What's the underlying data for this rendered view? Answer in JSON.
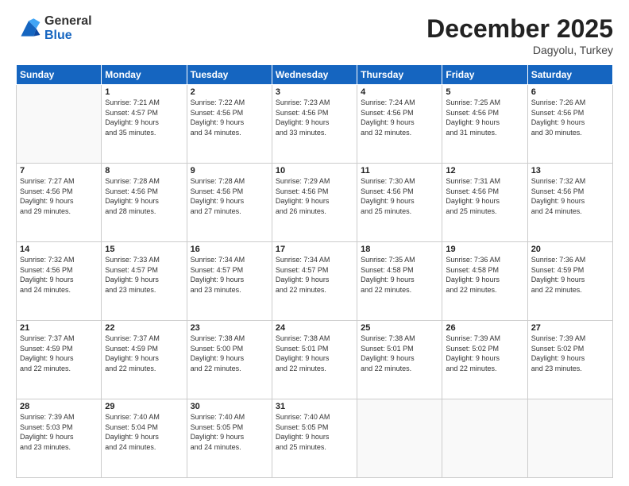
{
  "header": {
    "logo_general": "General",
    "logo_blue": "Blue",
    "month": "December 2025",
    "location": "Dagyolu, Turkey"
  },
  "weekdays": [
    "Sunday",
    "Monday",
    "Tuesday",
    "Wednesday",
    "Thursday",
    "Friday",
    "Saturday"
  ],
  "weeks": [
    [
      {
        "day": "",
        "info": ""
      },
      {
        "day": "1",
        "info": "Sunrise: 7:21 AM\nSunset: 4:57 PM\nDaylight: 9 hours\nand 35 minutes."
      },
      {
        "day": "2",
        "info": "Sunrise: 7:22 AM\nSunset: 4:56 PM\nDaylight: 9 hours\nand 34 minutes."
      },
      {
        "day": "3",
        "info": "Sunrise: 7:23 AM\nSunset: 4:56 PM\nDaylight: 9 hours\nand 33 minutes."
      },
      {
        "day": "4",
        "info": "Sunrise: 7:24 AM\nSunset: 4:56 PM\nDaylight: 9 hours\nand 32 minutes."
      },
      {
        "day": "5",
        "info": "Sunrise: 7:25 AM\nSunset: 4:56 PM\nDaylight: 9 hours\nand 31 minutes."
      },
      {
        "day": "6",
        "info": "Sunrise: 7:26 AM\nSunset: 4:56 PM\nDaylight: 9 hours\nand 30 minutes."
      }
    ],
    [
      {
        "day": "7",
        "info": "Sunrise: 7:27 AM\nSunset: 4:56 PM\nDaylight: 9 hours\nand 29 minutes."
      },
      {
        "day": "8",
        "info": "Sunrise: 7:28 AM\nSunset: 4:56 PM\nDaylight: 9 hours\nand 28 minutes."
      },
      {
        "day": "9",
        "info": "Sunrise: 7:28 AM\nSunset: 4:56 PM\nDaylight: 9 hours\nand 27 minutes."
      },
      {
        "day": "10",
        "info": "Sunrise: 7:29 AM\nSunset: 4:56 PM\nDaylight: 9 hours\nand 26 minutes."
      },
      {
        "day": "11",
        "info": "Sunrise: 7:30 AM\nSunset: 4:56 PM\nDaylight: 9 hours\nand 25 minutes."
      },
      {
        "day": "12",
        "info": "Sunrise: 7:31 AM\nSunset: 4:56 PM\nDaylight: 9 hours\nand 25 minutes."
      },
      {
        "day": "13",
        "info": "Sunrise: 7:32 AM\nSunset: 4:56 PM\nDaylight: 9 hours\nand 24 minutes."
      }
    ],
    [
      {
        "day": "14",
        "info": "Sunrise: 7:32 AM\nSunset: 4:56 PM\nDaylight: 9 hours\nand 24 minutes."
      },
      {
        "day": "15",
        "info": "Sunrise: 7:33 AM\nSunset: 4:57 PM\nDaylight: 9 hours\nand 23 minutes."
      },
      {
        "day": "16",
        "info": "Sunrise: 7:34 AM\nSunset: 4:57 PM\nDaylight: 9 hours\nand 23 minutes."
      },
      {
        "day": "17",
        "info": "Sunrise: 7:34 AM\nSunset: 4:57 PM\nDaylight: 9 hours\nand 22 minutes."
      },
      {
        "day": "18",
        "info": "Sunrise: 7:35 AM\nSunset: 4:58 PM\nDaylight: 9 hours\nand 22 minutes."
      },
      {
        "day": "19",
        "info": "Sunrise: 7:36 AM\nSunset: 4:58 PM\nDaylight: 9 hours\nand 22 minutes."
      },
      {
        "day": "20",
        "info": "Sunrise: 7:36 AM\nSunset: 4:59 PM\nDaylight: 9 hours\nand 22 minutes."
      }
    ],
    [
      {
        "day": "21",
        "info": "Sunrise: 7:37 AM\nSunset: 4:59 PM\nDaylight: 9 hours\nand 22 minutes."
      },
      {
        "day": "22",
        "info": "Sunrise: 7:37 AM\nSunset: 4:59 PM\nDaylight: 9 hours\nand 22 minutes."
      },
      {
        "day": "23",
        "info": "Sunrise: 7:38 AM\nSunset: 5:00 PM\nDaylight: 9 hours\nand 22 minutes."
      },
      {
        "day": "24",
        "info": "Sunrise: 7:38 AM\nSunset: 5:01 PM\nDaylight: 9 hours\nand 22 minutes."
      },
      {
        "day": "25",
        "info": "Sunrise: 7:38 AM\nSunset: 5:01 PM\nDaylight: 9 hours\nand 22 minutes."
      },
      {
        "day": "26",
        "info": "Sunrise: 7:39 AM\nSunset: 5:02 PM\nDaylight: 9 hours\nand 22 minutes."
      },
      {
        "day": "27",
        "info": "Sunrise: 7:39 AM\nSunset: 5:02 PM\nDaylight: 9 hours\nand 23 minutes."
      }
    ],
    [
      {
        "day": "28",
        "info": "Sunrise: 7:39 AM\nSunset: 5:03 PM\nDaylight: 9 hours\nand 23 minutes."
      },
      {
        "day": "29",
        "info": "Sunrise: 7:40 AM\nSunset: 5:04 PM\nDaylight: 9 hours\nand 24 minutes."
      },
      {
        "day": "30",
        "info": "Sunrise: 7:40 AM\nSunset: 5:05 PM\nDaylight: 9 hours\nand 24 minutes."
      },
      {
        "day": "31",
        "info": "Sunrise: 7:40 AM\nSunset: 5:05 PM\nDaylight: 9 hours\nand 25 minutes."
      },
      {
        "day": "",
        "info": ""
      },
      {
        "day": "",
        "info": ""
      },
      {
        "day": "",
        "info": ""
      }
    ]
  ]
}
